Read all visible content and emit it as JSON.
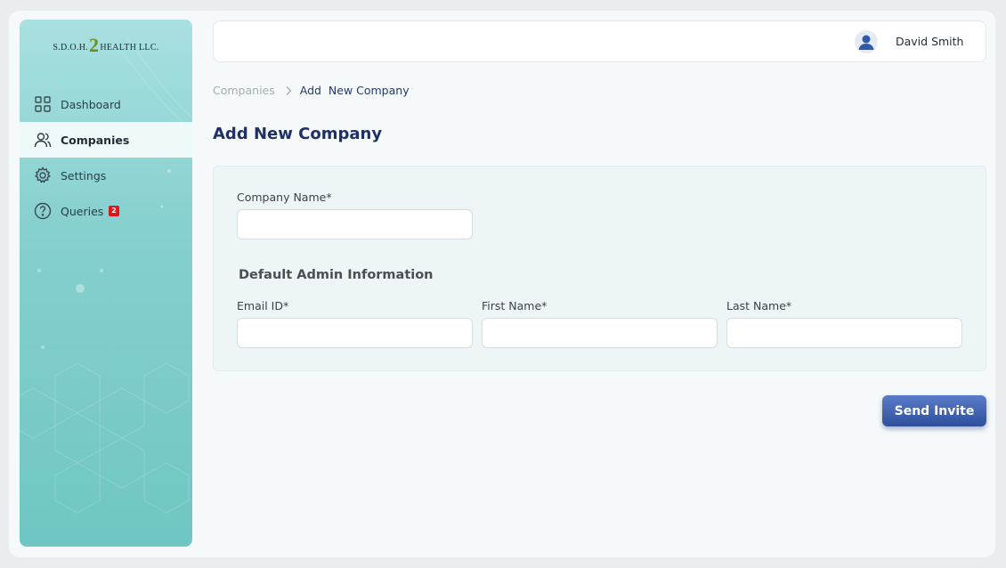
{
  "logo": {
    "left": "S.D.O.H.",
    "mid": "2",
    "right": "HEALTH LLC."
  },
  "sidebar": {
    "items": [
      {
        "label": "Dashboard",
        "icon": "grid-icon"
      },
      {
        "label": "Companies",
        "icon": "users-icon",
        "active": true
      },
      {
        "label": "Settings",
        "icon": "gear-icon"
      },
      {
        "label": "Queries",
        "icon": "help-circle-icon",
        "badge": "2"
      }
    ]
  },
  "header": {
    "user_name": "David Smith"
  },
  "breadcrumb": {
    "parent": "Companies",
    "current": "Add  New Company"
  },
  "page": {
    "title": "Add New Company"
  },
  "form": {
    "company_name_label": "Company Name*",
    "company_name_value": "",
    "admin_section_title": "Default Admin Information",
    "email_label": "Email ID*",
    "email_value": "",
    "first_name_label": "First Name*",
    "first_name_value": "",
    "last_name_label": "Last Name*",
    "last_name_value": "",
    "submit_label": "Send Invite"
  },
  "colors": {
    "primary": "#1f3164",
    "button": "#3a5cad",
    "sidebar": "#86d0cf",
    "badge": "#e0161e"
  }
}
